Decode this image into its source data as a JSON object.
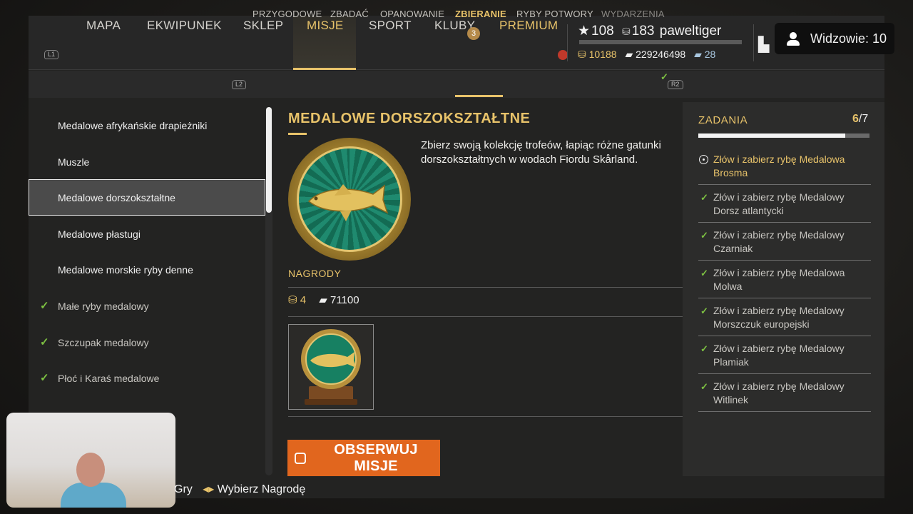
{
  "nav": {
    "left_shoulder": "L1",
    "items": [
      "MAPA",
      "EKWIPUNEK",
      "SKLEP",
      "MISJE",
      "SPORT",
      "KLUBY",
      "PREMIUM"
    ],
    "clubs_badge": "3"
  },
  "player": {
    "level": "108",
    "rank": "183",
    "name": "paweltiger",
    "xp_progress": 0.0,
    "gold": "10188",
    "silver": "229246498",
    "baits": "28"
  },
  "viewers": {
    "label": "Widzowie: 10"
  },
  "subnav": {
    "left_shoulder": "L2",
    "right_shoulder": "R2",
    "items": [
      "PRZYGODOWE",
      "ZBADAĆ",
      "OPANOWANIE",
      "ZBIERANIE",
      "RYBY POTWORY",
      "WYDARZENIA"
    ]
  },
  "missions": [
    "Medalowe afrykańskie drapieżniki",
    "Muszle",
    "Medalowe dorszokształtne",
    "Medalowe płastugi",
    "Medalowe morskie ryby denne",
    "Małe ryby medalowy",
    "Szczupak medalowy",
    "Płoć i Karaś medalowe"
  ],
  "detail": {
    "title": "MEDALOWE DORSZOKSZTAŁTNE",
    "description": "Zbierz swoją kolekcję trofeów, łapiąc różne gatunki dorszokształtnych w wodach Fiordu Skårland.",
    "rewards_heading": "NAGRODY",
    "reward_gold": "4",
    "reward_silver": "71100",
    "observe_button": "OBSERWUJ MISJE"
  },
  "tasks": {
    "heading": "ZADANIA",
    "done": "6",
    "total": "/7",
    "progress": 0.857,
    "items": [
      "Złów i zabierz rybę Medalowa Brosma",
      "Złów i zabierz rybę Medalowy Dorsz atlantycki",
      "Złów i zabierz rybę Medalowy Czarniak",
      "Złów i zabierz rybę Medalowa Molwa",
      "Złów i zabierz rybę Medalowy Morszczuk europejski",
      "Złów i zabierz rybę Medalowy Plamiak",
      "Złów i zabierz rybę Medalowy Witlinek"
    ]
  },
  "footer": {
    "hint_left": "Gry",
    "hint_right": "Wybierz Nagrodę"
  },
  "colors": {
    "accent_gold": "#e8c36a",
    "check_green": "#7dc142",
    "observe_orange": "#e1661e"
  }
}
